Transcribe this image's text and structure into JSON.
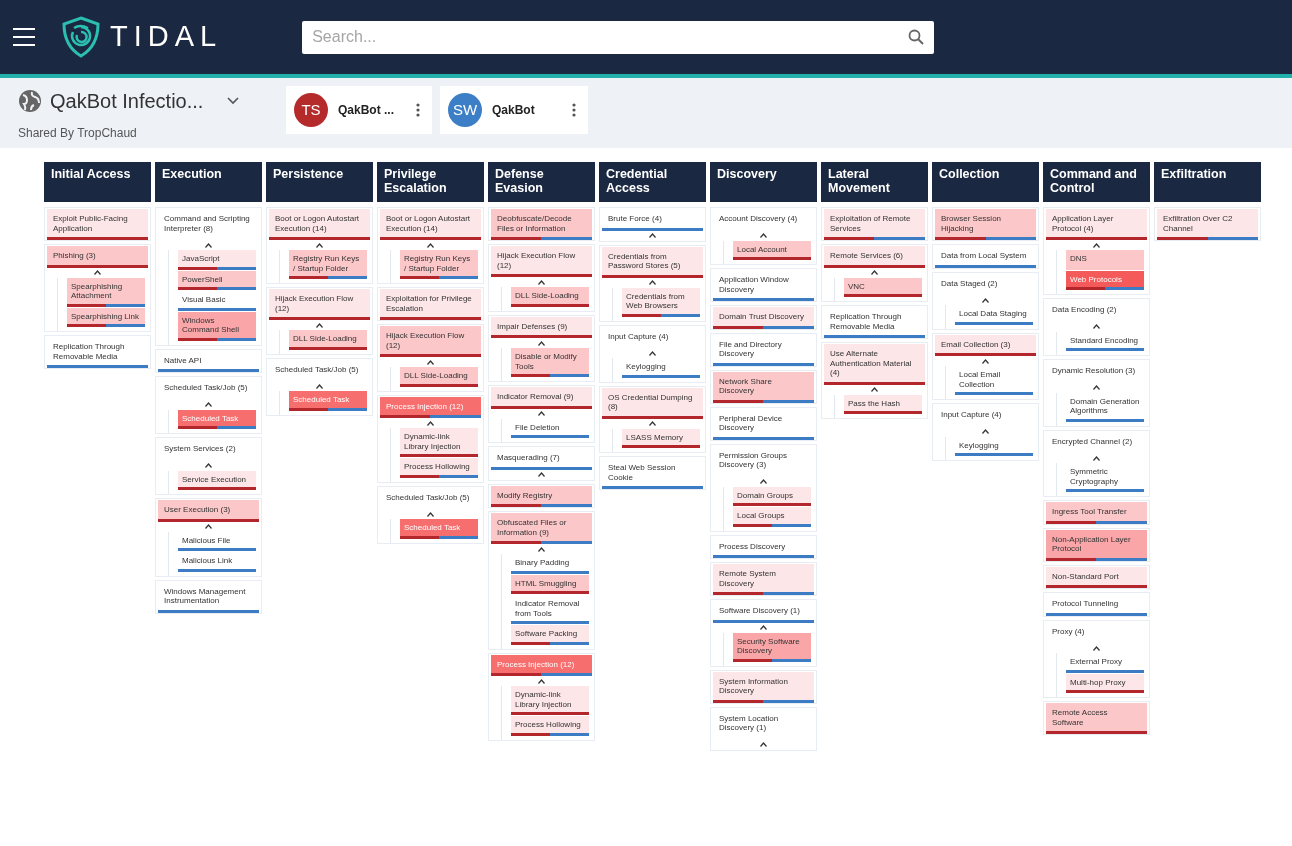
{
  "header": {
    "logo_text": "TIDAL",
    "search": {
      "placeholder": "Search..."
    }
  },
  "matrix_info": {
    "title": "QakBot Infectio...",
    "shared_by": "Shared By TropChaud"
  },
  "layers": [
    {
      "initials": "TS",
      "name": "QakBot ...",
      "color": "#b52a2a"
    },
    {
      "initials": "SW",
      "name": "QakBot",
      "color": "#3c7fc6"
    }
  ],
  "tactics": [
    {
      "name": "Initial Access",
      "techniques": [
        {
          "name": "Exploit Public-Facing Application",
          "color": "#fde6e8",
          "in_ts_layer": true,
          "in_sw_layer": false,
          "expanded": false
        },
        {
          "name": "Phishing (3)",
          "color": "#fcc7c9",
          "in_ts_layer": true,
          "in_sw_layer": false,
          "expanded": true,
          "children": [
            {
              "name": "Spearphishing Attachment",
              "color": "#fcc7c9",
              "in_ts_layer": true,
              "in_sw_layer": true
            },
            {
              "name": "Spearphishing Link",
              "color": "#fcc7c9",
              "in_ts_layer": true,
              "in_sw_layer": true
            }
          ]
        },
        {
          "name": "Replication Through Removable Media",
          "color": "#ffffff",
          "in_ts_layer": false,
          "in_sw_layer": true,
          "expanded": false
        }
      ]
    },
    {
      "name": "Execution",
      "techniques": [
        {
          "name": "Command and Scripting Interpreter (8)",
          "color": "#ffffff",
          "in_ts_layer": false,
          "in_sw_layer": false,
          "expanded": true,
          "children": [
            {
              "name": "JavaScript",
              "color": "#fde6e8",
              "in_ts_layer": true,
              "in_sw_layer": true
            },
            {
              "name": "PowerShell",
              "color": "#fcc7c9",
              "in_ts_layer": true,
              "in_sw_layer": true
            },
            {
              "name": "Visual Basic",
              "color": "#ffffff",
              "in_ts_layer": false,
              "in_sw_layer": true
            },
            {
              "name": "Windows Command Shell",
              "color": "#faa6a8",
              "in_ts_layer": true,
              "in_sw_layer": true
            }
          ]
        },
        {
          "name": "Native API",
          "color": "#ffffff",
          "in_ts_layer": false,
          "in_sw_layer": true,
          "expanded": false
        },
        {
          "name": "Scheduled Task/Job (5)",
          "color": "#ffffff",
          "in_ts_layer": false,
          "in_sw_layer": false,
          "expanded": true,
          "children": [
            {
              "name": "Scheduled Task",
              "color": "#f76e6e",
              "in_ts_layer": true,
              "in_sw_layer": true
            }
          ]
        },
        {
          "name": "System Services (2)",
          "color": "#ffffff",
          "in_ts_layer": false,
          "in_sw_layer": false,
          "expanded": true,
          "children": [
            {
              "name": "Service Execution",
              "color": "#fde6e8",
              "in_ts_layer": true,
              "in_sw_layer": false
            }
          ]
        },
        {
          "name": "User Execution (3)",
          "color": "#fcc7c9",
          "in_ts_layer": true,
          "in_sw_layer": false,
          "expanded": true,
          "children": [
            {
              "name": "Malicious File",
              "color": "#ffffff",
              "in_ts_layer": false,
              "in_sw_layer": true
            },
            {
              "name": "Malicious Link",
              "color": "#ffffff",
              "in_ts_layer": false,
              "in_sw_layer": true
            }
          ]
        },
        {
          "name": "Windows Management Instrumentation",
          "color": "#ffffff",
          "in_ts_layer": false,
          "in_sw_layer": true,
          "expanded": false
        }
      ]
    },
    {
      "name": "Persistence",
      "techniques": [
        {
          "name": "Boot or Logon Autostart Execution (14)",
          "color": "#fde6e8",
          "in_ts_layer": true,
          "in_sw_layer": false,
          "expanded": true,
          "children": [
            {
              "name": "Registry Run Keys / Startup Folder",
              "color": "#fcc7c9",
              "in_ts_layer": true,
              "in_sw_layer": true
            }
          ]
        },
        {
          "name": "Hijack Execution Flow (12)",
          "color": "#fde6e8",
          "in_ts_layer": true,
          "in_sw_layer": false,
          "expanded": true,
          "children": [
            {
              "name": "DLL Side-Loading",
              "color": "#fcc7c9",
              "in_ts_layer": true,
              "in_sw_layer": false
            }
          ]
        },
        {
          "name": "Scheduled Task/Job (5)",
          "color": "#ffffff",
          "in_ts_layer": false,
          "in_sw_layer": false,
          "expanded": true,
          "children": [
            {
              "name": "Scheduled Task",
              "color": "#f76e6e",
              "in_ts_layer": true,
              "in_sw_layer": true
            }
          ]
        }
      ]
    },
    {
      "name": "Privilege Escalation",
      "techniques": [
        {
          "name": "Boot or Logon Autostart Execution (14)",
          "color": "#fde6e8",
          "in_ts_layer": true,
          "in_sw_layer": false,
          "expanded": true,
          "children": [
            {
              "name": "Registry Run Keys / Startup Folder",
              "color": "#fcc7c9",
              "in_ts_layer": true,
              "in_sw_layer": true
            }
          ]
        },
        {
          "name": "Exploitation for Privilege Escalation",
          "color": "#fde6e8",
          "in_ts_layer": true,
          "in_sw_layer": false,
          "expanded": false
        },
        {
          "name": "Hijack Execution Flow (12)",
          "color": "#fcc7c9",
          "in_ts_layer": true,
          "in_sw_layer": false,
          "expanded": true,
          "children": [
            {
              "name": "DLL Side-Loading",
              "color": "#fcc7c9",
              "in_ts_layer": true,
              "in_sw_layer": false
            }
          ]
        },
        {
          "name": "Process Injection (12)",
          "color": "#f76e6e",
          "in_ts_layer": true,
          "in_sw_layer": true,
          "expanded": true,
          "children": [
            {
              "name": "Dynamic-link Library Injection",
              "color": "#fde6e8",
              "in_ts_layer": true,
              "in_sw_layer": false
            },
            {
              "name": "Process Hollowing",
              "color": "#fde6e8",
              "in_ts_layer": true,
              "in_sw_layer": true
            }
          ]
        },
        {
          "name": "Scheduled Task/Job (5)",
          "color": "#ffffff",
          "in_ts_layer": false,
          "in_sw_layer": false,
          "expanded": true,
          "children": [
            {
              "name": "Scheduled Task",
              "color": "#f76e6e",
              "in_ts_layer": true,
              "in_sw_layer": true
            }
          ]
        }
      ]
    },
    {
      "name": "Defense Evasion",
      "techniques": [
        {
          "name": "Deobfuscate/Decode Files or Information",
          "color": "#fcc7c9",
          "in_ts_layer": true,
          "in_sw_layer": true,
          "expanded": false
        },
        {
          "name": "Hijack Execution Flow (12)",
          "color": "#fde6e8",
          "in_ts_layer": true,
          "in_sw_layer": false,
          "expanded": true,
          "children": [
            {
              "name": "DLL Side-Loading",
              "color": "#fcc7c9",
              "in_ts_layer": true,
              "in_sw_layer": false
            }
          ]
        },
        {
          "name": "Impair Defenses (9)",
          "color": "#fde6e8",
          "in_ts_layer": true,
          "in_sw_layer": false,
          "expanded": true,
          "children": [
            {
              "name": "Disable or Modify Tools",
              "color": "#fcc7c9",
              "in_ts_layer": true,
              "in_sw_layer": true
            }
          ]
        },
        {
          "name": "Indicator Removal (9)",
          "color": "#fde6e8",
          "in_ts_layer": true,
          "in_sw_layer": false,
          "expanded": true,
          "children": [
            {
              "name": "File Deletion",
              "color": "#ffffff",
              "in_ts_layer": false,
              "in_sw_layer": true
            }
          ]
        },
        {
          "name": "Masquerading (7)",
          "color": "#ffffff",
          "in_ts_layer": false,
          "in_sw_layer": true,
          "expanded": true
        },
        {
          "name": "Modify Registry",
          "color": "#fcc7c9",
          "in_ts_layer": true,
          "in_sw_layer": true,
          "expanded": false
        },
        {
          "name": "Obfuscated Files or Information (9)",
          "color": "#fcc7c9",
          "in_ts_layer": true,
          "in_sw_layer": true,
          "expanded": true,
          "children": [
            {
              "name": "Binary Padding",
              "color": "#ffffff",
              "in_ts_layer": false,
              "in_sw_layer": true
            },
            {
              "name": "HTML Smuggling",
              "color": "#fcc7c9",
              "in_ts_layer": true,
              "in_sw_layer": false
            },
            {
              "name": "Indicator Removal from Tools",
              "color": "#ffffff",
              "in_ts_layer": false,
              "in_sw_layer": true
            },
            {
              "name": "Software Packing",
              "color": "#fde6e8",
              "in_ts_layer": true,
              "in_sw_layer": true
            }
          ]
        },
        {
          "name": "Process Injection (12)",
          "color": "#f76e6e",
          "in_ts_layer": true,
          "in_sw_layer": true,
          "expanded": true,
          "children": [
            {
              "name": "Dynamic-link Library Injection",
              "color": "#fde6e8",
              "in_ts_layer": true,
              "in_sw_layer": false
            },
            {
              "name": "Process Hollowing",
              "color": "#fde6e8",
              "in_ts_layer": true,
              "in_sw_layer": true
            }
          ]
        }
      ]
    },
    {
      "name": "Credential Access",
      "techniques": [
        {
          "name": "Brute Force (4)",
          "color": "#ffffff",
          "in_ts_layer": false,
          "in_sw_layer": true,
          "expanded": true
        },
        {
          "name": "Credentials from Password Stores (5)",
          "color": "#fde6e8",
          "in_ts_layer": true,
          "in_sw_layer": false,
          "expanded": true,
          "children": [
            {
              "name": "Credentials from Web Browsers",
              "color": "#fde6e8",
              "in_ts_layer": true,
              "in_sw_layer": true
            }
          ]
        },
        {
          "name": "Input Capture (4)",
          "color": "#ffffff",
          "in_ts_layer": false,
          "in_sw_layer": false,
          "expanded": true,
          "children": [
            {
              "name": "Keylogging",
              "color": "#ffffff",
              "in_ts_layer": false,
              "in_sw_layer": true
            }
          ]
        },
        {
          "name": "OS Credential Dumping (8)",
          "color": "#fde6e8",
          "in_ts_layer": true,
          "in_sw_layer": false,
          "expanded": true,
          "children": [
            {
              "name": "LSASS Memory",
              "color": "#fde6e8",
              "in_ts_layer": true,
              "in_sw_layer": false
            }
          ]
        },
        {
          "name": "Steal Web Session Cookie",
          "color": "#ffffff",
          "in_ts_layer": false,
          "in_sw_layer": true,
          "expanded": false
        }
      ]
    },
    {
      "name": "Discovery",
      "techniques": [
        {
          "name": "Account Discovery (4)",
          "color": "#ffffff",
          "in_ts_layer": false,
          "in_sw_layer": false,
          "expanded": true,
          "children": [
            {
              "name": "Local Account",
              "color": "#fcc7c9",
              "in_ts_layer": true,
              "in_sw_layer": false
            }
          ]
        },
        {
          "name": "Application Window Discovery",
          "color": "#ffffff",
          "in_ts_layer": false,
          "in_sw_layer": true,
          "expanded": false
        },
        {
          "name": "Domain Trust Discovery",
          "color": "#fde6e8",
          "in_ts_layer": true,
          "in_sw_layer": true,
          "expanded": false
        },
        {
          "name": "File and Directory Discovery",
          "color": "#ffffff",
          "in_ts_layer": false,
          "in_sw_layer": true,
          "expanded": false
        },
        {
          "name": "Network Share Discovery",
          "color": "#fcc7c9",
          "in_ts_layer": true,
          "in_sw_layer": true,
          "expanded": false
        },
        {
          "name": "Peripheral Device Discovery",
          "color": "#ffffff",
          "in_ts_layer": false,
          "in_sw_layer": true,
          "expanded": false
        },
        {
          "name": "Permission Groups Discovery (3)",
          "color": "#ffffff",
          "in_ts_layer": false,
          "in_sw_layer": false,
          "expanded": true,
          "children": [
            {
              "name": "Domain Groups",
              "color": "#fde6e8",
              "in_ts_layer": true,
              "in_sw_layer": false
            },
            {
              "name": "Local Groups",
              "color": "#fde6e8",
              "in_ts_layer": true,
              "in_sw_layer": true
            }
          ]
        },
        {
          "name": "Process Discovery",
          "color": "#ffffff",
          "in_ts_layer": false,
          "in_sw_layer": true,
          "expanded": false
        },
        {
          "name": "Remote System Discovery",
          "color": "#fde6e8",
          "in_ts_layer": true,
          "in_sw_layer": true,
          "expanded": false
        },
        {
          "name": "Software Discovery (1)",
          "color": "#ffffff",
          "in_ts_layer": false,
          "in_sw_layer": true,
          "expanded": true,
          "children": [
            {
              "name": "Security Software Discovery",
              "color": "#faa6a8",
              "in_ts_layer": true,
              "in_sw_layer": true
            }
          ]
        },
        {
          "name": "System Information Discovery",
          "color": "#fde6e8",
          "in_ts_layer": true,
          "in_sw_layer": true,
          "expanded": false
        },
        {
          "name": "System Location Discovery (1)",
          "color": "#ffffff",
          "in_ts_layer": false,
          "in_sw_layer": false,
          "expanded": true
        }
      ]
    },
    {
      "name": "Lateral Movement",
      "techniques": [
        {
          "name": "Exploitation of Remote Services",
          "color": "#fde6e8",
          "in_ts_layer": true,
          "in_sw_layer": true,
          "expanded": false
        },
        {
          "name": "Remote Services (6)",
          "color": "#fde6e8",
          "in_ts_layer": true,
          "in_sw_layer": false,
          "expanded": true,
          "children": [
            {
              "name": "VNC",
              "color": "#fcc7c9",
              "in_ts_layer": true,
              "in_sw_layer": false
            }
          ]
        },
        {
          "name": "Replication Through Removable Media",
          "color": "#ffffff",
          "in_ts_layer": false,
          "in_sw_layer": true,
          "expanded": false
        },
        {
          "name": "Use Alternate Authentication Material (4)",
          "color": "#fde6e8",
          "in_ts_layer": true,
          "in_sw_layer": false,
          "expanded": true,
          "children": [
            {
              "name": "Pass the Hash",
              "color": "#fde6e8",
              "in_ts_layer": true,
              "in_sw_layer": false
            }
          ]
        }
      ]
    },
    {
      "name": "Collection",
      "techniques": [
        {
          "name": "Browser Session Hijacking",
          "color": "#fcc7c9",
          "in_ts_layer": true,
          "in_sw_layer": true,
          "expanded": false
        },
        {
          "name": "Data from Local System",
          "color": "#ffffff",
          "in_ts_layer": false,
          "in_sw_layer": true,
          "expanded": false
        },
        {
          "name": "Data Staged (2)",
          "color": "#ffffff",
          "in_ts_layer": false,
          "in_sw_layer": false,
          "expanded": true,
          "children": [
            {
              "name": "Local Data Staging",
              "color": "#ffffff",
              "in_ts_layer": false,
              "in_sw_layer": true
            }
          ]
        },
        {
          "name": "Email Collection (3)",
          "color": "#fde6e8",
          "in_ts_layer": true,
          "in_sw_layer": false,
          "expanded": true,
          "children": [
            {
              "name": "Local Email Collection",
              "color": "#ffffff",
              "in_ts_layer": false,
              "in_sw_layer": true
            }
          ]
        },
        {
          "name": "Input Capture (4)",
          "color": "#ffffff",
          "in_ts_layer": false,
          "in_sw_layer": false,
          "expanded": true,
          "children": [
            {
              "name": "Keylogging",
              "color": "#ffffff",
              "in_ts_layer": false,
              "in_sw_layer": true
            }
          ]
        }
      ]
    },
    {
      "name": "Command and Control",
      "techniques": [
        {
          "name": "Application Layer Protocol (4)",
          "color": "#fde6e8",
          "in_ts_layer": true,
          "in_sw_layer": false,
          "expanded": true,
          "children": [
            {
              "name": "DNS",
              "color": "#fcc7c9",
              "in_ts_layer": false,
              "in_sw_layer": false
            },
            {
              "name": "Web Protocols",
              "color": "#f55a5a",
              "in_ts_layer": true,
              "in_sw_layer": true
            }
          ]
        },
        {
          "name": "Data Encoding (2)",
          "color": "#ffffff",
          "in_ts_layer": false,
          "in_sw_layer": false,
          "expanded": true,
          "children": [
            {
              "name": "Standard Encoding",
              "color": "#ffffff",
              "in_ts_layer": false,
              "in_sw_layer": true
            }
          ]
        },
        {
          "name": "Dynamic Resolution (3)",
          "color": "#ffffff",
          "in_ts_layer": false,
          "in_sw_layer": false,
          "expanded": true,
          "children": [
            {
              "name": "Domain Generation Algorithms",
              "color": "#ffffff",
              "in_ts_layer": false,
              "in_sw_layer": true
            }
          ]
        },
        {
          "name": "Encrypted Channel (2)",
          "color": "#ffffff",
          "in_ts_layer": false,
          "in_sw_layer": false,
          "expanded": true,
          "children": [
            {
              "name": "Symmetric Cryptography",
              "color": "#ffffff",
              "in_ts_layer": false,
              "in_sw_layer": true
            }
          ]
        },
        {
          "name": "Ingress Tool Transfer",
          "color": "#fcc7c9",
          "in_ts_layer": true,
          "in_sw_layer": true,
          "expanded": false
        },
        {
          "name": "Non-Application Layer Protocol",
          "color": "#faa6a8",
          "in_ts_layer": true,
          "in_sw_layer": true,
          "expanded": false
        },
        {
          "name": "Non-Standard Port",
          "color": "#fde6e8",
          "in_ts_layer": true,
          "in_sw_layer": false,
          "expanded": false
        },
        {
          "name": "Protocol Tunneling",
          "color": "#ffffff",
          "in_ts_layer": false,
          "in_sw_layer": true,
          "expanded": false
        },
        {
          "name": "Proxy (4)",
          "color": "#ffffff",
          "in_ts_layer": false,
          "in_sw_layer": false,
          "expanded": true,
          "children": [
            {
              "name": "External Proxy",
              "color": "#ffffff",
              "in_ts_layer": false,
              "in_sw_layer": true
            },
            {
              "name": "Multi-hop Proxy",
              "color": "#fde6e8",
              "in_ts_layer": true,
              "in_sw_layer": false
            }
          ]
        },
        {
          "name": "Remote Access Software",
          "color": "#fcc7c9",
          "in_ts_layer": true,
          "in_sw_layer": false,
          "expanded": false
        }
      ]
    },
    {
      "name": "Exfiltration",
      "techniques": [
        {
          "name": "Exfiltration Over C2 Channel",
          "color": "#fde6e8",
          "in_ts_layer": true,
          "in_sw_layer": true,
          "expanded": false
        }
      ]
    }
  ]
}
